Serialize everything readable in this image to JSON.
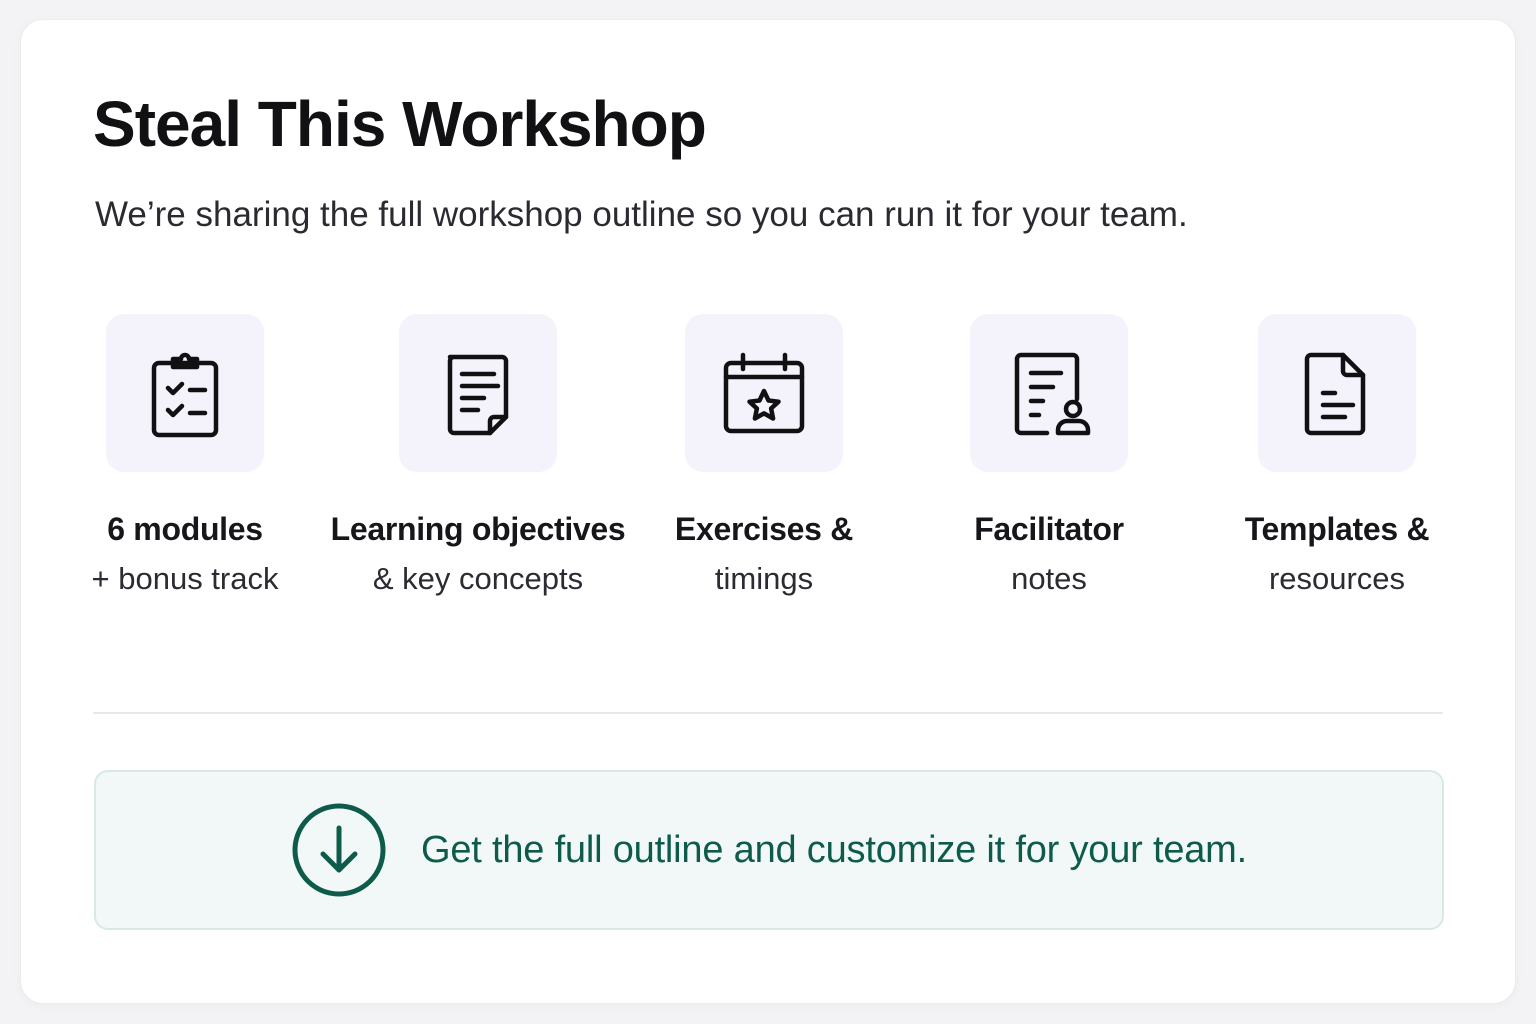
{
  "header": {
    "title": "Steal This Workshop",
    "subtitle": "We’re sharing the full workshop outline so you can run it for your team."
  },
  "features": [
    {
      "line1": "6 modules",
      "line2": "+ bonus track",
      "icon": "clipboard-checklist-icon"
    },
    {
      "line1": "Learning objectives",
      "line2": "& key concepts",
      "icon": "document-lines-icon"
    },
    {
      "line1": "Exercises &",
      "line2": "timings",
      "icon": "calendar-star-icon"
    },
    {
      "line1": "Facilitator",
      "line2": "notes",
      "icon": "document-person-icon"
    },
    {
      "line1": "Templates &",
      "line2": "resources",
      "icon": "file-text-icon"
    }
  ],
  "cta": {
    "label": "Get the full outline and customize it for your team.",
    "icon": "download-arrow-icon"
  },
  "colors": {
    "accent": "#0e5b4c",
    "icon_tile_bg": "#f4f3fb",
    "cta_bg": "#f1f8f7"
  }
}
